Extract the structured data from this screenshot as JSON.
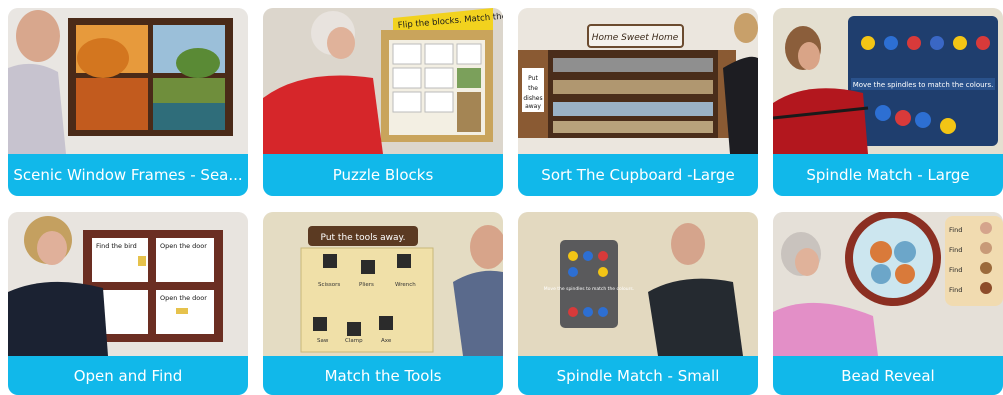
{
  "products": [
    {
      "title": "Scenic Window Frames - Sea...",
      "image_text": []
    },
    {
      "title": "Puzzle Blocks",
      "image_text": [
        "Flip the blocks. Match the pairs."
      ]
    },
    {
      "title": "Sort The Cupboard -Large",
      "image_text": [
        "Home Sweet Home",
        "Put the dishes away"
      ]
    },
    {
      "title": "Spindle Match - Large",
      "image_text": [
        "Move the spindles to match the colours."
      ]
    },
    {
      "title": "Open and Find",
      "image_text": [
        "Find the bird",
        "Open the door",
        "Open the door"
      ]
    },
    {
      "title": "Match the Tools",
      "image_text": [
        "Put the tools away.",
        "Scissors",
        "Pliers",
        "Wrench",
        "Saw",
        "Clamp",
        "Axe"
      ]
    },
    {
      "title": "Spindle Match - Small",
      "image_text": [
        "Move the spindles to match the colours."
      ]
    },
    {
      "title": "Bead Reveal",
      "image_text": [
        "Find",
        "Find",
        "Find",
        "Find"
      ]
    }
  ]
}
